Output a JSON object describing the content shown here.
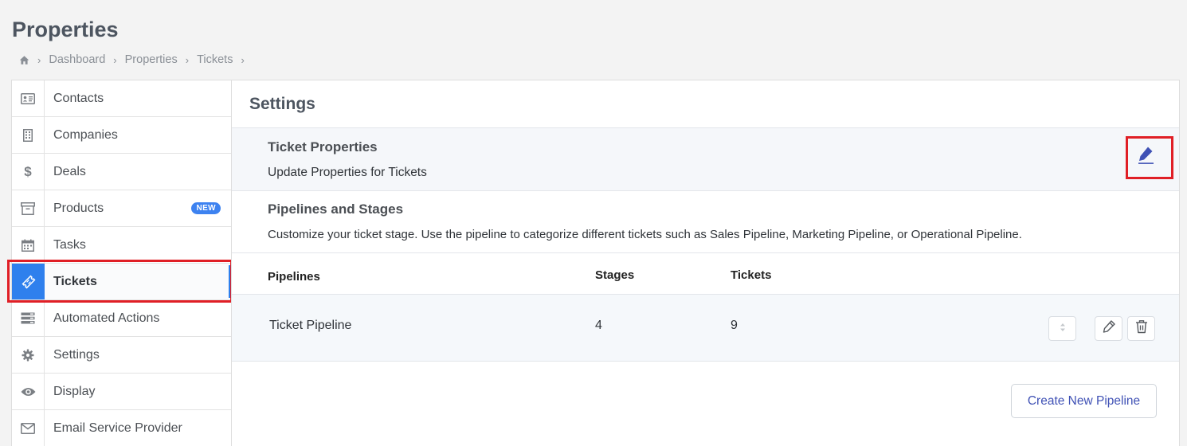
{
  "page": {
    "title": "Properties"
  },
  "breadcrumb": {
    "home_icon": "home-icon",
    "items": [
      "Dashboard",
      "Properties",
      "Tickets"
    ]
  },
  "sidebar": {
    "items": [
      {
        "label": "Contacts",
        "icon": "contact-card-icon"
      },
      {
        "label": "Companies",
        "icon": "building-icon"
      },
      {
        "label": "Deals",
        "icon": "dollar-icon"
      },
      {
        "label": "Products",
        "icon": "archive-box-icon",
        "badge": "NEW"
      },
      {
        "label": "Tasks",
        "icon": "calendar-icon"
      },
      {
        "label": "Tickets",
        "icon": "ticket-icon",
        "active": true
      },
      {
        "label": "Automated Actions",
        "icon": "server-stack-icon"
      },
      {
        "label": "Settings",
        "icon": "gear-icon"
      },
      {
        "label": "Display",
        "icon": "eye-icon"
      },
      {
        "label": "Email Service Provider",
        "icon": "envelope-icon"
      }
    ]
  },
  "main": {
    "title": "Settings",
    "ticket_properties": {
      "title": "Ticket Properties",
      "description": "Update Properties for Tickets",
      "edit_icon": "pencil-icon"
    },
    "pipelines_section": {
      "title": "Pipelines and Stages",
      "description": "Customize your ticket stage. Use the pipeline to categorize different tickets such as Sales Pipeline, Marketing Pipeline, or Operational Pipeline."
    },
    "table": {
      "headers": {
        "pipelines": "Pipelines",
        "stages": "Stages",
        "tickets": "Tickets"
      },
      "rows": [
        {
          "pipeline": "Ticket Pipeline",
          "stages": "4",
          "tickets": "9"
        }
      ]
    },
    "create_button": "Create New Pipeline"
  },
  "colors": {
    "accent": "#2f80ed",
    "highlight": "#e01f26",
    "button_text": "#3f51b5"
  }
}
